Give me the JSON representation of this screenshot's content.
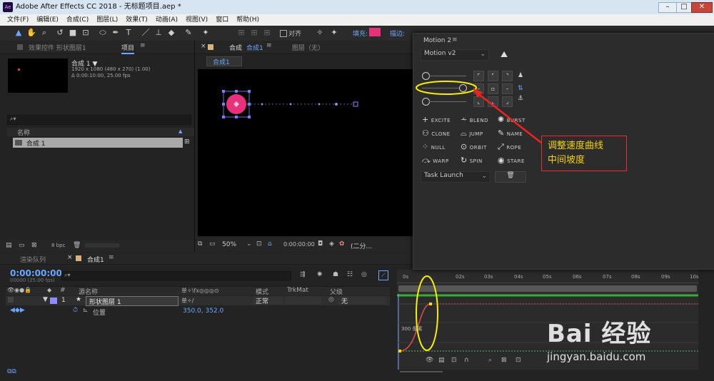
{
  "window": {
    "title": "Adobe After Effects CC 2018 - 无标题项目.aep *"
  },
  "menu": [
    "文件(F)",
    "编辑(E)",
    "合成(C)",
    "图层(L)",
    "效果(T)",
    "动画(A)",
    "视图(V)",
    "窗口",
    "帮助(H)"
  ],
  "toolbar": {
    "align_label": "对齐",
    "fill_label": "填充:",
    "stroke_label": "描边:",
    "fill_color": "#e8317a"
  },
  "project": {
    "tab_effects": "效果控件 形状图层1",
    "tab_project": "项目",
    "comp_name": "合成 1 ▼",
    "comp_info1": "1920 x 1080 (480 x 270) (1.00)",
    "comp_info2": "Δ 0:00:10:00, 25.00 fps",
    "col_name": "名称",
    "item_name": "合成 1",
    "bpc": "8 bpc"
  },
  "comp_viewer": {
    "tab_comp": "合成",
    "tab_comp_name": "合成1",
    "tab_layer": "图层（无）",
    "breadcrumb": "合成1",
    "zoom": "50%",
    "timecode": "0:00:00:00",
    "quality": "(二分..."
  },
  "timeline": {
    "tab_render": "渲染队列",
    "tab_comp": "合成1",
    "timecode": "0:00:00:00",
    "frame_info": "00000 (25.00 fps)",
    "col_source": "源名称",
    "col_mode": "模式",
    "col_trkmat": "TrkMat",
    "col_parent": "父级",
    "layer_num": "1",
    "layer_name": "形状图层 1",
    "layer_mode": "正常",
    "layer_parent": "无",
    "prop_name": "位置",
    "prop_value": "350.0, 352.0",
    "ruler": [
      "0s",
      "02s",
      "03s",
      "04s",
      "05s",
      "06s",
      "07s",
      "08s",
      "09s",
      "10s"
    ],
    "graph_value": "300 像素"
  },
  "motion": {
    "title": "Motion 2",
    "version": "Motion v2",
    "tools": [
      {
        "label": "EXCITE",
        "icon": "plus-icon"
      },
      {
        "label": "BLEND",
        "icon": "blend-icon"
      },
      {
        "label": "BURST",
        "icon": "burst-icon"
      },
      {
        "label": "CLONE",
        "icon": "clone-icon"
      },
      {
        "label": "JUMP",
        "icon": "jump-icon"
      },
      {
        "label": "NAME",
        "icon": "pencil-icon"
      },
      {
        "label": "NULL",
        "icon": "null-icon"
      },
      {
        "label": "ORBIT",
        "icon": "orbit-icon"
      },
      {
        "label": "ROPE",
        "icon": "rope-icon"
      },
      {
        "label": "WARP",
        "icon": "warp-icon"
      },
      {
        "label": "SPIN",
        "icon": "spin-icon"
      },
      {
        "label": "STARE",
        "icon": "eye-icon"
      }
    ],
    "task": "Task Launch"
  },
  "annotation": {
    "line1": "调整速度曲线",
    "line2": "中间坡度"
  },
  "watermark": {
    "text": "Bai 经验",
    "url": "jingyan.baidu.com"
  }
}
